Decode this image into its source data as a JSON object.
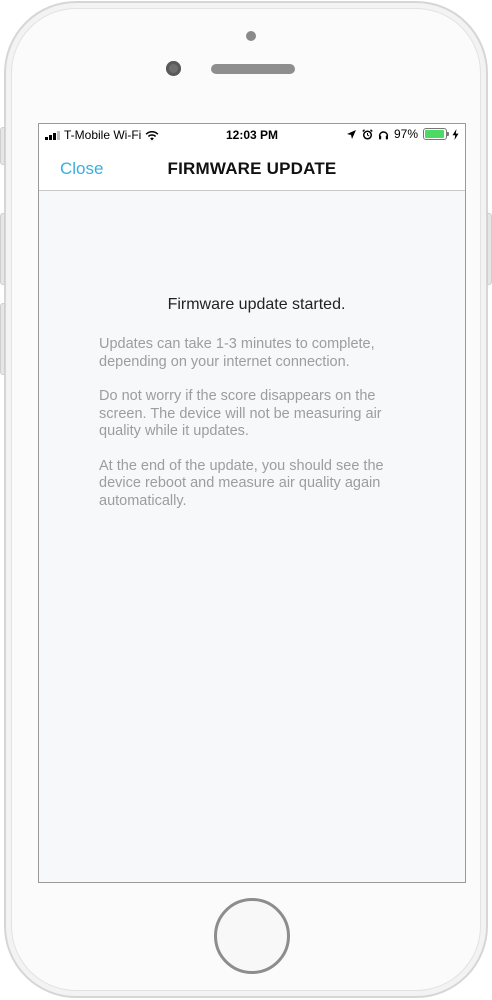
{
  "status_bar": {
    "carrier": "T-Mobile Wi-Fi",
    "time": "12:03 PM",
    "battery_percent": "97%",
    "battery_level": 0.97,
    "battery_color": "#4cd964",
    "icons": [
      "cellular-signal-icon",
      "wifi-icon",
      "location-arrow-icon",
      "alarm-clock-icon",
      "headphones-icon",
      "battery-icon",
      "charging-bolt-icon"
    ]
  },
  "nav": {
    "close_label": "Close",
    "title": "FIRMWARE UPDATE",
    "accent_color": "#3aaee0"
  },
  "content": {
    "heading": "Firmware update started.",
    "paragraphs": [
      "Updates can take 1-3 minutes to complete, depending on your internet connection.",
      "Do not worry if the score disappears on the screen. The device will not be measuring air quality while it updates.",
      "At the end of the update, you should see the device reboot and measure air quality again automatically."
    ]
  }
}
